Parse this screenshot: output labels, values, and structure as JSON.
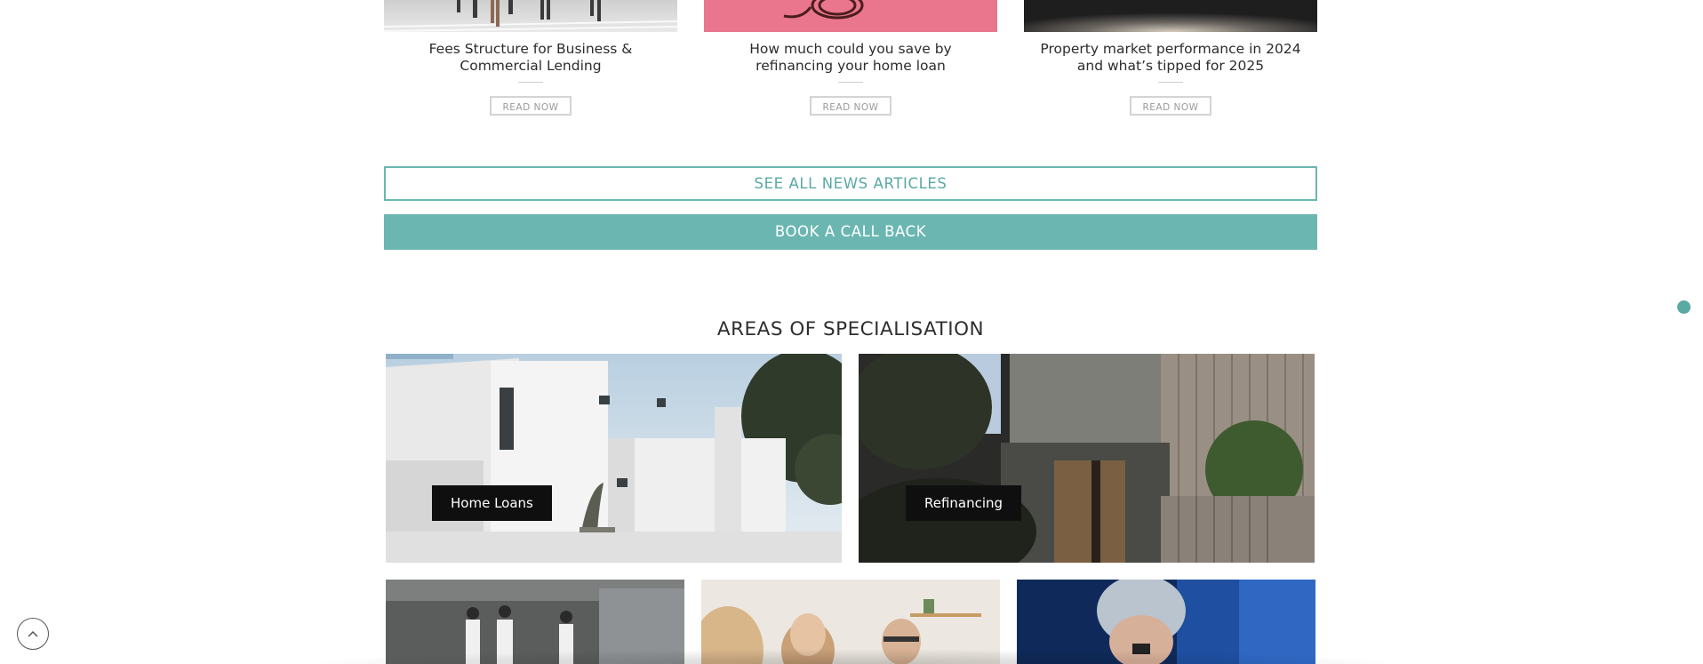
{
  "articles": [
    {
      "title": "Fees Structure for Business & Commercial Lending",
      "button": "READ NOW"
    },
    {
      "title": "How much could you save by refinancing your home loan",
      "button": "READ NOW"
    },
    {
      "title": "Property market performance in 2024 and what’s tipped for 2025",
      "button": "READ NOW"
    }
  ],
  "actions": {
    "see_all": "SEE ALL NEWS ARTICLES",
    "book_call": "BOOK A CALL BACK"
  },
  "specialisation": {
    "heading": "AREAS OF SPECIALISATION",
    "tiles": [
      {
        "label": "Home Loans"
      },
      {
        "label": "Refinancing"
      }
    ]
  },
  "icons": {
    "scroll_top": "chevron-up-icon",
    "chat": "chat-dot-icon"
  },
  "colors": {
    "accent": "#6bb6b1",
    "accent_text": "#5aa9a4",
    "label_bg": "#0f0f0f"
  }
}
